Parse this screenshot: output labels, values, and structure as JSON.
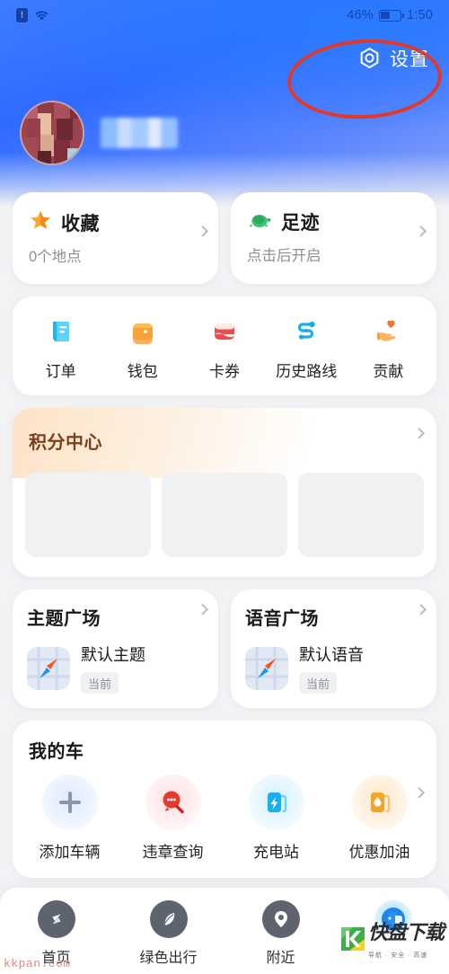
{
  "status_bar": {
    "alert_icon": "alert-badge-icon",
    "wifi_icon": "wifi-icon",
    "battery_percent": "46%",
    "battery_level": 46,
    "battery_icon": "battery-icon",
    "time": "1:50"
  },
  "header": {
    "settings_label": "设置",
    "settings_icon": "hex-gear-icon",
    "annotation": "red-ellipse-highlight",
    "username": "",
    "username_state": "redacted",
    "avatar": "user-avatar"
  },
  "shortcut_cards": [
    {
      "title": "收藏",
      "subtitle": "0个地点",
      "icon": "star-icon"
    },
    {
      "title": "足迹",
      "subtitle": "点击后开启",
      "icon": "turtle-icon"
    }
  ],
  "quick_links": [
    {
      "label": "订单",
      "icon": "order-book-icon"
    },
    {
      "label": "钱包",
      "icon": "wallet-icon"
    },
    {
      "label": "卡券",
      "icon": "coupon-card-icon"
    },
    {
      "label": "历史路线",
      "icon": "route-history-icon"
    },
    {
      "label": "贡献",
      "icon": "hand-heart-icon"
    }
  ],
  "points_center": {
    "title": "积分中心",
    "chevron": "chevron-right-icon",
    "placeholder_count": 3,
    "state": "loading"
  },
  "plaza_cards": [
    {
      "title": "主题广场",
      "name": "默认主题",
      "badge": "当前",
      "thumb": "map-compass-thumb"
    },
    {
      "title": "语音广场",
      "name": "默认语音",
      "badge": "当前",
      "thumb": "map-compass-thumb"
    }
  ],
  "my_car": {
    "title": "我的车",
    "chevron": "chevron-right-icon",
    "items": [
      {
        "label": "添加车辆",
        "icon": "plus-icon"
      },
      {
        "label": "违章查询",
        "icon": "violation-search-icon"
      },
      {
        "label": "充电站",
        "icon": "charging-station-icon"
      },
      {
        "label": "优惠加油",
        "icon": "fuel-pump-icon"
      }
    ]
  },
  "tab_bar": [
    {
      "label": "首页",
      "icon": "compass-icon",
      "active": false
    },
    {
      "label": "绿色出行",
      "icon": "leaf-icon",
      "active": false
    },
    {
      "label": "附近",
      "icon": "location-pin-icon",
      "active": false
    },
    {
      "label": "",
      "icon": "profile-avatar-icon",
      "active": true
    }
  ],
  "watermarks": {
    "site": "kkpan.com",
    "logo_text": "快盘下载",
    "logo_sub": "导航 · 安全 · 高速"
  },
  "colors": {
    "header_blue": "#2f6bff",
    "accent_red": "#e0392c",
    "page_bg": "#f2f3f5",
    "card_bg": "#ffffff",
    "points_brown": "#7b3f1d",
    "muted": "#8d8f96"
  }
}
